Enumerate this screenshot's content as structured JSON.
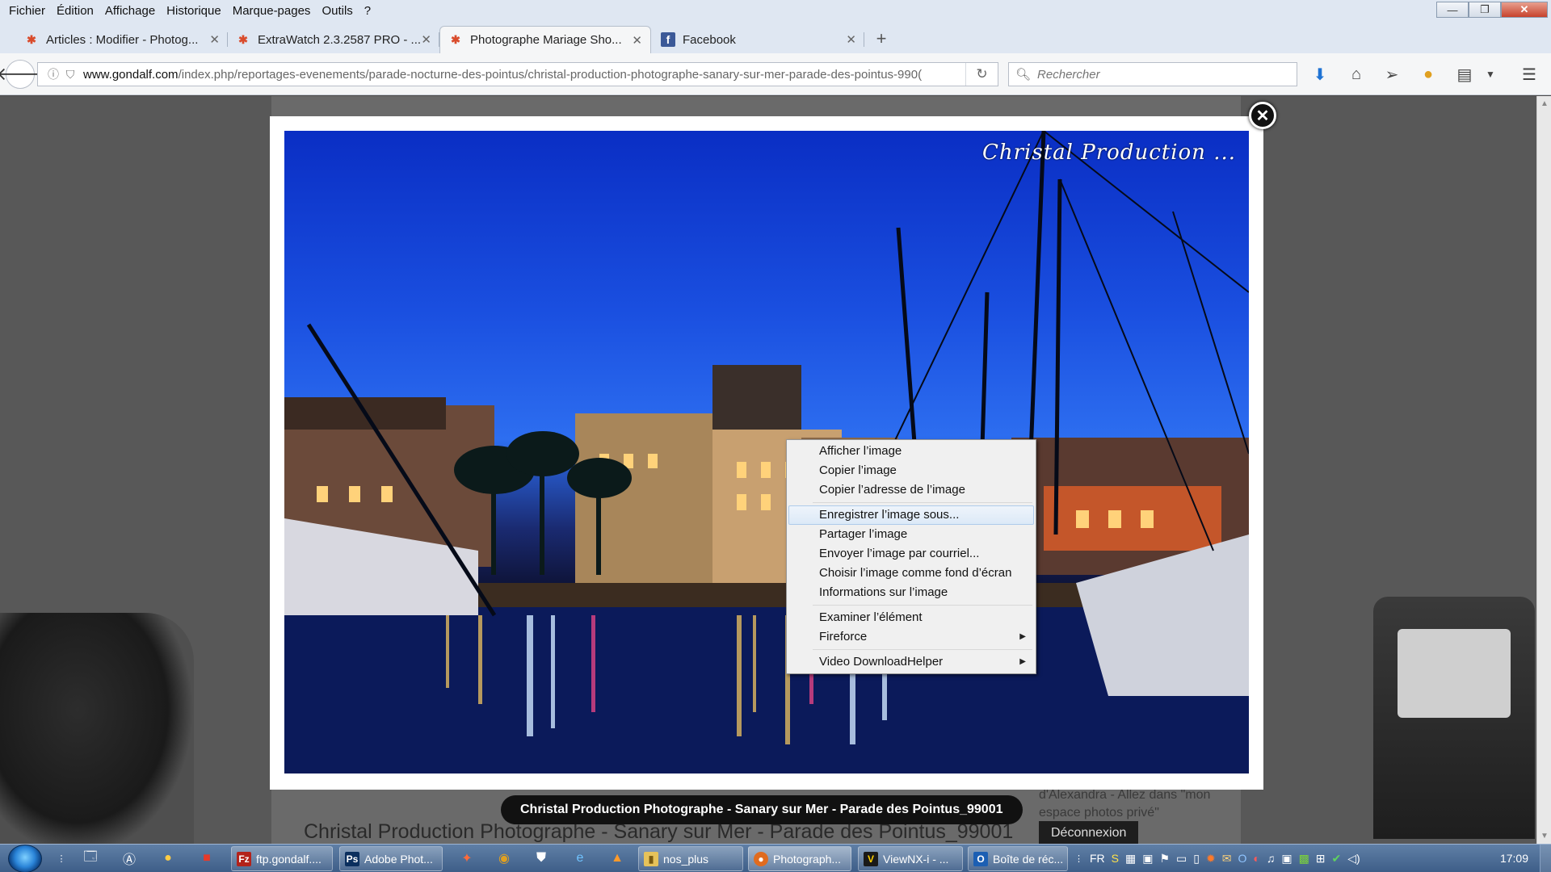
{
  "menu": [
    "Fichier",
    "Édition",
    "Affichage",
    "Historique",
    "Marque-pages",
    "Outils",
    "?"
  ],
  "tabs": [
    {
      "title": "Articles : Modifier - Photog...",
      "icon": "joomla-icon",
      "active": false
    },
    {
      "title": "ExtraWatch 2.3.2587 PRO - ...",
      "icon": "joomla-icon",
      "active": false
    },
    {
      "title": "Photographe Mariage Sho...",
      "icon": "joomla-icon",
      "active": true
    },
    {
      "title": "Facebook",
      "icon": "facebook-icon",
      "active": false
    }
  ],
  "url": {
    "domain": "www.gondalf.com",
    "path": "/index.php/reportages-evenements/parade-nocturne-des-pointus/christal-production-photographe-sanary-sur-mer-parade-des-pointus-990("
  },
  "search": {
    "placeholder": "Rechercher"
  },
  "lightbox": {
    "watermark": "Christal Production ...",
    "caption": "Christal Production Photographe - Sanary sur Mer - Parade des Pointus_99001"
  },
  "context_menu": [
    {
      "label": "Afficher l’image"
    },
    {
      "label": "Copier l’image"
    },
    {
      "label": "Copier l’adresse de l’image"
    },
    {
      "separator": true
    },
    {
      "label": "Enregistrer l’image sous...",
      "highlighted": true
    },
    {
      "label": "Partager l’image"
    },
    {
      "label": "Envoyer l’image par courriel..."
    },
    {
      "label": "Choisir l’image comme fond d’écran"
    },
    {
      "label": "Informations sur l’image"
    },
    {
      "separator": true
    },
    {
      "label": "Examiner l’élément"
    },
    {
      "label": "Fireforce",
      "submenu": true
    },
    {
      "separator": true
    },
    {
      "label": "Video DownloadHelper",
      "submenu": true
    }
  ],
  "page": {
    "title": "Christal Production Photographe - Sanary sur Mer - Parade des Pointus_99001",
    "side_text": "d'Alexandra - Allez dans \"mon espace photos privé\"",
    "logout": "Déconnexion"
  },
  "taskbar": {
    "tasks": [
      {
        "label": "ftp.gondalf....",
        "icon": "filezilla-icon",
        "color": "#b3221a",
        "glyph": "Fz"
      },
      {
        "label": "Adobe Phot...",
        "icon": "photoshop-icon",
        "color": "#0b2f5e",
        "glyph": "Ps"
      },
      {
        "label": "nos_plus",
        "icon": "folder-icon",
        "color": "#e6c25a",
        "glyph": "▮"
      },
      {
        "label": "Photograph...",
        "icon": "firefox-icon",
        "color": "#e06b1f",
        "glyph": "●"
      },
      {
        "label": "ViewNX-i - ...",
        "icon": "viewnx-icon",
        "color": "#1a1a1a",
        "glyph": "V"
      },
      {
        "label": "Boîte de réc...",
        "icon": "outlook-icon",
        "color": "#1c5fb3",
        "glyph": "O"
      }
    ],
    "language": "FR",
    "time": "17:09"
  }
}
